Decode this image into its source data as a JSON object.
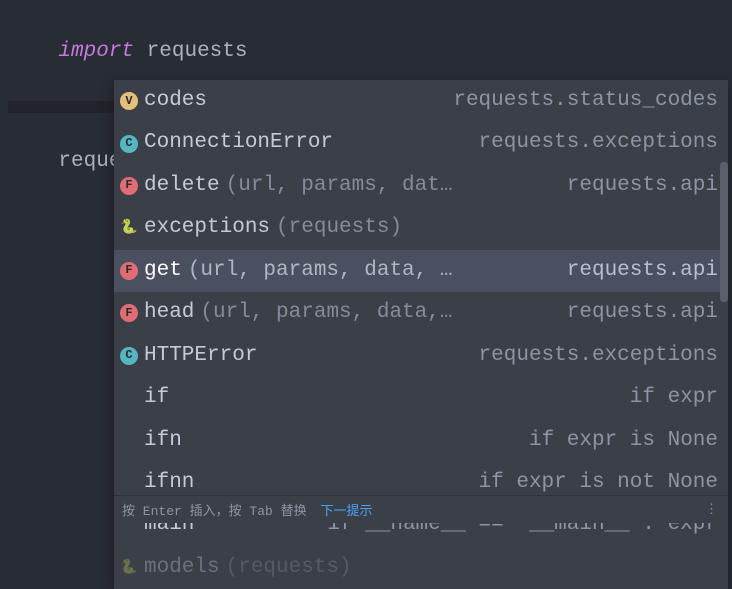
{
  "code": {
    "line1_kw": "import",
    "line1_mod": "requests",
    "line2_prefix": "requests",
    "line2_dot": "."
  },
  "popup": {
    "items": [
      {
        "badge": "v",
        "name": "codes",
        "params": "",
        "detail": "requests.status_codes",
        "selected": false
      },
      {
        "badge": "c",
        "name": "ConnectionError",
        "params": "",
        "detail": "requests.exceptions",
        "selected": false
      },
      {
        "badge": "f",
        "name": "delete",
        "params": "(url, params, dat…",
        "detail": "requests.api",
        "selected": false
      },
      {
        "badge": "py",
        "name": "exceptions",
        "params": "(requests)",
        "detail": "",
        "selected": false
      },
      {
        "badge": "f",
        "name": "get",
        "params": "(url, params, data, …",
        "detail": "requests.api",
        "selected": true
      },
      {
        "badge": "f",
        "name": "head",
        "params": "(url, params, data,…",
        "detail": "requests.api",
        "selected": false
      },
      {
        "badge": "c",
        "name": "HTTPError",
        "params": "",
        "detail": "requests.exceptions",
        "selected": false
      },
      {
        "badge": "",
        "name": "if",
        "params": "",
        "detail": "if expr",
        "selected": false
      },
      {
        "badge": "",
        "name": "ifn",
        "params": "",
        "detail": "if expr is None",
        "selected": false
      },
      {
        "badge": "",
        "name": "ifnn",
        "params": "",
        "detail": "if expr is not None",
        "selected": false
      },
      {
        "badge": "",
        "name": "main",
        "params": "",
        "detail": "if __name__ == '__main__': expr",
        "selected": false
      },
      {
        "badge": "py",
        "name": "models",
        "params": "(requests)",
        "detail": "",
        "selected": false,
        "fade": true
      }
    ]
  },
  "footer": {
    "hint": "按 Enter 插入，按 Tab 替换",
    "link": "下一提示",
    "dots": "⋮"
  }
}
